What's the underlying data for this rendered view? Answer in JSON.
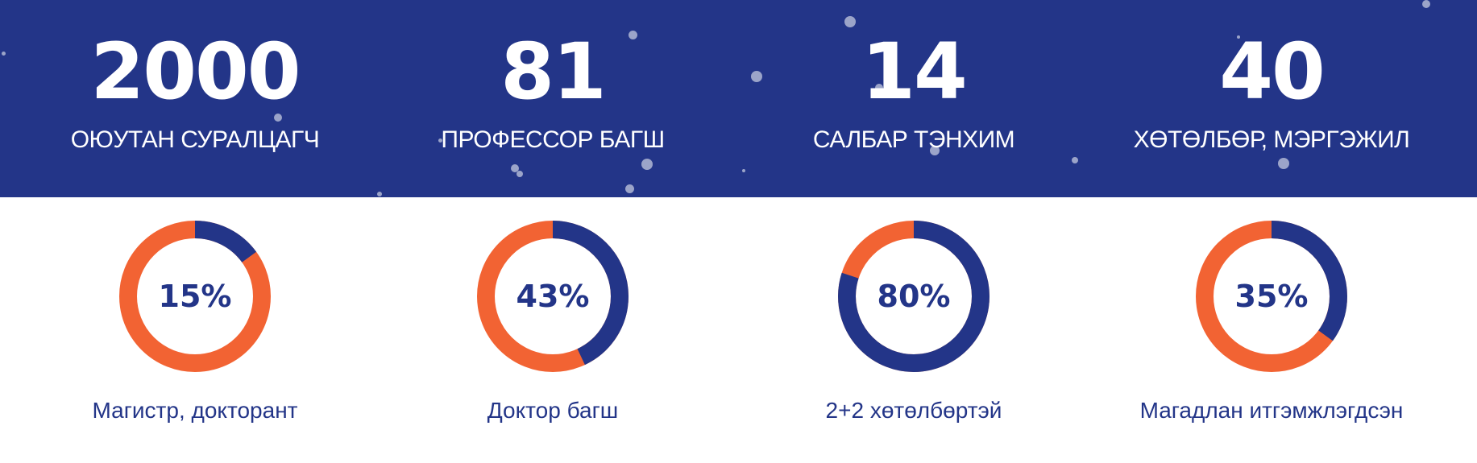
{
  "colors": {
    "banner_bg": "#233588",
    "ring_primary": "#233588",
    "ring_secondary": "#F26333",
    "text_on_banner": "#FFFFFF"
  },
  "stats": [
    {
      "number": "2000",
      "label": "ОЮУТАН СУРАЛЦАГЧ"
    },
    {
      "number": "81",
      "label": "ПРОФЕССОР БАГШ"
    },
    {
      "number": "14",
      "label": "САЛБАР ТЭНХИМ"
    },
    {
      "number": "40",
      "label": "ХӨТӨЛБӨР, МЭРГЭЖИЛ"
    }
  ],
  "rings": [
    {
      "percent": 15,
      "percent_text": "15%",
      "label": "Магистр, докторант"
    },
    {
      "percent": 43,
      "percent_text": "43%",
      "label": "Доктор багш"
    },
    {
      "percent": 80,
      "percent_text": "80%",
      "label": "2+2 хөтөлбөртэй"
    },
    {
      "percent": 35,
      "percent_text": "35%",
      "label": "Магадлан итгэмжлэгдсэн"
    }
  ]
}
